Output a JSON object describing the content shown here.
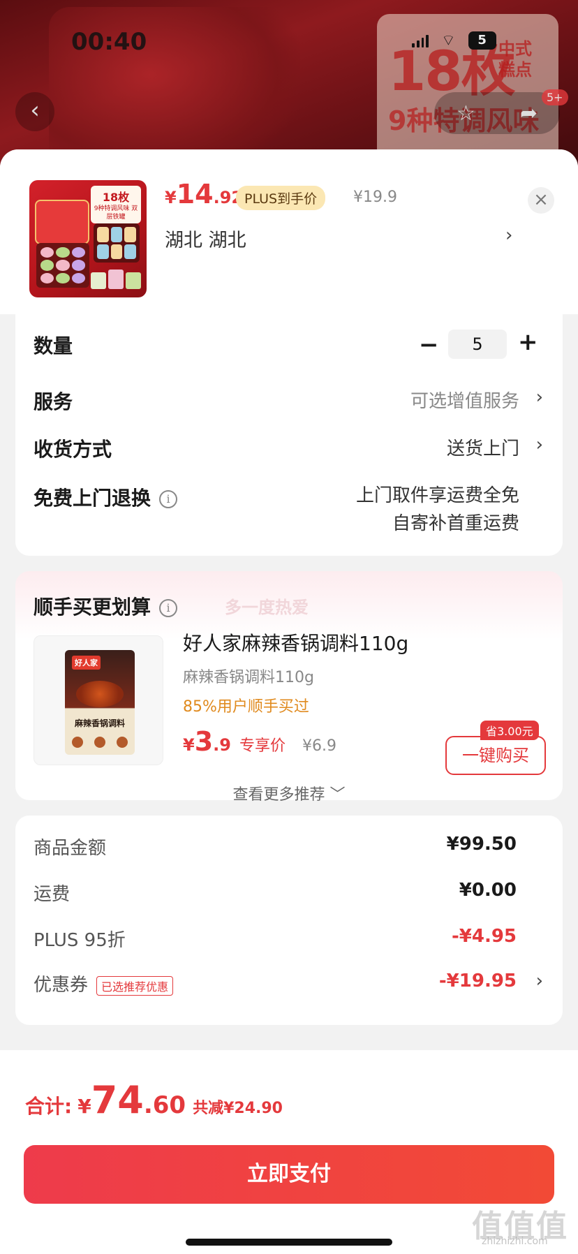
{
  "status_bar": {
    "time": "00:40",
    "battery": "5"
  },
  "background": {
    "promo_big": "18枚",
    "promo_sub": "中式糕点",
    "promo_flavor": "9种特调风味",
    "cart_badge": "5+"
  },
  "product": {
    "currency": "¥",
    "price_int": "14",
    "price_dec": ".92",
    "plus_tag": "PLUS到手价",
    "orig_price": "¥19.9",
    "address": "湖北  湖北",
    "thumb_title": "18枚",
    "thumb_sub": "9种特调风味 双层铁罐"
  },
  "options": {
    "quantity_label": "数量",
    "quantity_value": "5",
    "minus": "−",
    "plus": "+",
    "service_label": "服务",
    "service_value": "可选增值服务",
    "delivery_label": "收货方式",
    "delivery_value": "送货上门",
    "return_label": "免费上门退换",
    "return_line1": "上门取件享运费全免",
    "return_line2": "自寄补首重运费"
  },
  "recommend": {
    "title": "顺手买更划算",
    "watermark": "多一度热爱",
    "name": "好人家麻辣香锅调料110g",
    "spec": "麻辣香锅调料110g",
    "stat": "85%用户顺手买过",
    "currency": "¥",
    "price_int": "3",
    "price_dec": ".9",
    "exclusive": "专享价",
    "orig_price": "¥6.9",
    "save_badge": "省3.00元",
    "buy_button": "一键购买",
    "more": "查看更多推荐 ﹀",
    "brand": "好人家",
    "bag_name": "麻辣香锅调料"
  },
  "fees": {
    "items": [
      {
        "label": "商品金额",
        "value": "¥99.50"
      },
      {
        "label": "运费",
        "value": "¥0.00"
      },
      {
        "label": "PLUS 95折",
        "value": "-¥4.95"
      },
      {
        "label": "优惠券",
        "value": "-¥19.95",
        "tag": "已选推荐优惠"
      }
    ]
  },
  "summary": {
    "total_label": "合计:",
    "currency": "¥",
    "total_int": "74",
    "total_dec": ".60",
    "saved": "共减¥24.90",
    "pay_button": "立即支付"
  },
  "watermark": {
    "text": "值值值",
    "url": "zhizhizhi.com"
  },
  "colors": {
    "accent": "#e4393c",
    "plus_gold": "#fbe7b3",
    "orange_stat": "#e08a1e"
  }
}
